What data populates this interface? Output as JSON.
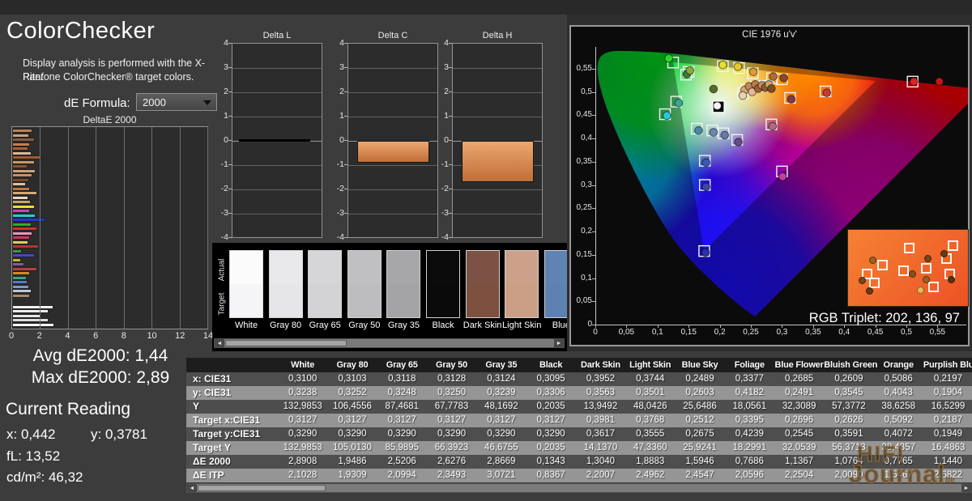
{
  "app": {
    "title": "ColorChecker",
    "description_line1": "Display analysis is performed with the X-Rite/",
    "description_line2": "Pantone ColorChecker® target colors.",
    "de_formula_label": "dE Formula:",
    "de_formula_value": "2000"
  },
  "stats": {
    "avg": "Avg dE2000: 1,44",
    "max": "Max dE2000: 2,89",
    "current_reading_label": "Current Reading",
    "x": "x: 0,442",
    "y": "y: 0,3781",
    "fl": "fL: 13,52",
    "cdm2": "cd/m²: 46,32"
  },
  "chart_data": [
    {
      "type": "bar",
      "title": "DeltaE 2000",
      "orientation": "horizontal",
      "xlim": [
        0,
        14
      ],
      "xticks": [
        "0",
        "2",
        "4",
        "6",
        "8",
        "10",
        "12",
        "14"
      ],
      "grid": true,
      "bars": [
        {
          "color": "#c08050",
          "value": 1.35
        },
        {
          "color": "#caa07a",
          "value": 1.1
        },
        {
          "color": "#8a5a3a",
          "value": 1.5
        },
        {
          "color": "#c08050",
          "value": 1.2
        },
        {
          "color": "#a86038",
          "value": 1.05
        },
        {
          "color": "#d8b896",
          "value": 1.3
        },
        {
          "color": "#a05a30",
          "value": 2.0
        },
        {
          "color": "#c8986a",
          "value": 1.5
        },
        {
          "color": "#905030",
          "value": 1.0
        },
        {
          "color": "#d0a070",
          "value": 1.6
        },
        {
          "color": "#c49068",
          "value": 1.35
        },
        {
          "color": "#7a4a2a",
          "value": 1.1
        },
        {
          "color": "#e0c0a0",
          "value": 0.85
        },
        {
          "color": "#b87848",
          "value": 1.15
        },
        {
          "color": "#d6a878",
          "value": 1.7
        },
        {
          "color": "#e8d8c0",
          "value": 1.05
        },
        {
          "color": "#caa06e",
          "value": 1.25
        },
        {
          "color": "#e8e030",
          "value": 1.55
        },
        {
          "color": "#d040c0",
          "value": 1.2
        },
        {
          "color": "#30c8d0",
          "value": 1.6
        },
        {
          "color": "#2038d0",
          "value": 2.3
        },
        {
          "color": "#28b028",
          "value": 1.3
        },
        {
          "color": "#d03030",
          "value": 1.7
        },
        {
          "color": "#e098b8",
          "value": 1.35
        },
        {
          "color": "#c03860",
          "value": 1.15
        },
        {
          "color": "#d8d060",
          "value": 1.05
        },
        {
          "color": "#b03838",
          "value": 1.8
        },
        {
          "color": "#489048",
          "value": 0.6
        },
        {
          "color": "#4848c0",
          "value": 1.5
        },
        {
          "color": "#b8b830",
          "value": 0.5
        },
        {
          "color": "#8858a8",
          "value": 0.75
        },
        {
          "color": "#b84040",
          "value": 1.7
        },
        {
          "color": "#d08830",
          "value": 1.2
        },
        {
          "color": "#38a878",
          "value": 0.95
        },
        {
          "color": "#5878c8",
          "value": 1.0
        },
        {
          "color": "#8898b8",
          "value": 1.1
        },
        {
          "color": "#b8c8d8",
          "value": 1.3
        },
        {
          "color": "#a88868",
          "value": 1.15
        }
      ],
      "white_bars": [
        {
          "color": "#f2f2f2",
          "value": 2.85
        },
        {
          "color": "#ececec",
          "value": 2.5
        },
        {
          "color": "#e6e6e6",
          "value": 2.0
        },
        {
          "color": "#dedede",
          "value": 2.5
        },
        {
          "color": "#f8f8f8",
          "value": 2.9
        }
      ]
    },
    {
      "type": "bar",
      "title": "Delta L",
      "ylim": [
        -4,
        4
      ],
      "yticks": [
        "4",
        "3",
        "2",
        "1",
        "0",
        "-1",
        "-2",
        "-3",
        "-4"
      ],
      "value": -0.05,
      "bar_style": "black"
    },
    {
      "type": "bar",
      "title": "Delta C",
      "ylim": [
        -4,
        4
      ],
      "yticks": [
        "4",
        "3",
        "2",
        "1",
        "0",
        "-1",
        "-2",
        "-3",
        "-4"
      ],
      "value": -0.9,
      "bar_style": "orange"
    },
    {
      "type": "bar",
      "title": "Delta H",
      "ylim": [
        -4,
        4
      ],
      "yticks": [
        "4",
        "3",
        "2",
        "1",
        "0",
        "-1",
        "-2",
        "-3",
        "-4"
      ],
      "value": -1.7,
      "bar_style": "orange"
    },
    {
      "type": "scatter",
      "title": "CIE 1976 u'v'",
      "xlim": [
        0,
        0.6
      ],
      "ylim": [
        0,
        0.6
      ],
      "xticks": [
        "0",
        "0,05",
        "0,1",
        "0,15",
        "0,2",
        "0,25",
        "0,3",
        "0,35",
        "0,4",
        "0,45",
        "0,5",
        "0,55"
      ],
      "yticks": [
        "0",
        "0,05",
        "0,1",
        "0,15",
        "0,2",
        "0,25",
        "0,3",
        "0,35",
        "0,4",
        "0,45",
        "0,5",
        "0,55"
      ],
      "whitepoint": {
        "u": 0.198,
        "v": 0.468
      },
      "targets": [
        [
          0.125,
          0.563
        ],
        [
          0.15,
          0.543
        ],
        [
          0.146,
          0.537
        ],
        [
          0.205,
          0.555
        ],
        [
          0.231,
          0.551
        ],
        [
          0.253,
          0.54
        ],
        [
          0.284,
          0.529
        ],
        [
          0.243,
          0.505
        ],
        [
          0.256,
          0.511
        ],
        [
          0.267,
          0.512
        ],
        [
          0.277,
          0.513
        ],
        [
          0.237,
          0.497
        ],
        [
          0.3,
          0.527
        ],
        [
          0.313,
          0.487
        ],
        [
          0.37,
          0.501
        ],
        [
          0.51,
          0.522
        ],
        [
          0.13,
          0.479
        ],
        [
          0.112,
          0.452
        ],
        [
          0.163,
          0.421
        ],
        [
          0.188,
          0.417
        ],
        [
          0.206,
          0.411
        ],
        [
          0.228,
          0.397
        ],
        [
          0.283,
          0.43
        ],
        [
          0.176,
          0.352
        ],
        [
          0.176,
          0.3
        ],
        [
          0.175,
          0.158
        ],
        [
          0.3,
          0.329
        ]
      ],
      "points": [
        [
          0.118,
          0.572,
          "#2fd42f"
        ],
        [
          0.147,
          0.538,
          "#3f7a30"
        ],
        [
          0.152,
          0.546,
          "#8aa83a"
        ],
        [
          0.19,
          0.506,
          "#5a6a2a"
        ],
        [
          0.205,
          0.558,
          "#e6df2e"
        ],
        [
          0.229,
          0.554,
          "#e8c62e"
        ],
        [
          0.254,
          0.543,
          "#e09a30"
        ],
        [
          0.286,
          0.533,
          "#b06c2e"
        ],
        [
          0.24,
          0.504,
          "#d8a878"
        ],
        [
          0.247,
          0.512,
          "#c08858"
        ],
        [
          0.252,
          0.5,
          "#e6b896"
        ],
        [
          0.257,
          0.516,
          "#b87a48"
        ],
        [
          0.262,
          0.507,
          "#a06030"
        ],
        [
          0.268,
          0.514,
          "#c89060"
        ],
        [
          0.273,
          0.509,
          "#8f5a28"
        ],
        [
          0.279,
          0.516,
          "#d0a070"
        ],
        [
          0.283,
          0.507,
          "#7e4e20"
        ],
        [
          0.237,
          0.492,
          "#ecd0b0"
        ],
        [
          0.303,
          0.53,
          "#8a4a2a"
        ],
        [
          0.315,
          0.484,
          "#803a4a"
        ],
        [
          0.372,
          0.498,
          "#c23a3a"
        ],
        [
          0.512,
          0.522,
          "#e02222"
        ],
        [
          0.553,
          0.522,
          "#c01818"
        ],
        [
          0.196,
          0.47,
          "#f4f4f4"
        ],
        [
          0.134,
          0.476,
          "#3aa898"
        ],
        [
          0.115,
          0.449,
          "#28c8d8"
        ],
        [
          0.166,
          0.417,
          "#4a88a8"
        ],
        [
          0.19,
          0.413,
          "#6888b0"
        ],
        [
          0.208,
          0.407,
          "#6878a8"
        ],
        [
          0.23,
          0.392,
          "#684a88"
        ],
        [
          0.285,
          0.426,
          "#b06a80"
        ],
        [
          0.178,
          0.348,
          "#3a58b8"
        ],
        [
          0.178,
          0.296,
          "#3848a0"
        ],
        [
          0.177,
          0.155,
          "#2830a8"
        ],
        [
          0.301,
          0.318,
          "#c2409a"
        ]
      ]
    }
  ],
  "cie": {
    "rgb_triplet": "RGB Triplet: 202, 136, 97",
    "inset_squares": [
      [
        0.52,
        0.2
      ],
      [
        0.27,
        0.47
      ],
      [
        0.13,
        0.62
      ],
      [
        0.2,
        0.75
      ],
      [
        0.47,
        0.57
      ],
      [
        0.68,
        0.52
      ],
      [
        0.75,
        0.82
      ],
      [
        0.87,
        0.37
      ],
      [
        0.93,
        0.17
      ],
      [
        0.9,
        0.62
      ]
    ],
    "inset_dots": [
      [
        0.18,
        0.4,
        "#a06020"
      ],
      [
        0.08,
        0.72,
        "#7a4418"
      ],
      [
        0.15,
        0.88,
        "#6a3a14"
      ],
      [
        0.55,
        0.62,
        "#8a5020"
      ],
      [
        0.63,
        0.87,
        "#e8b850"
      ],
      [
        0.7,
        0.37,
        "#7a4418"
      ],
      [
        0.85,
        0.3,
        "#6a3a14"
      ],
      [
        0.92,
        0.7,
        "#5a3210"
      ],
      [
        0.68,
        0.7,
        "#9a6028"
      ]
    ]
  },
  "swatches": {
    "actual_label": "Actual",
    "target_label": "Target",
    "items": [
      {
        "name": "White",
        "actual": "#fbfbfb",
        "target": "#f5f5f7"
      },
      {
        "name": "Gray 80",
        "actual": "#e9e9eb",
        "target": "#e6e6e8"
      },
      {
        "name": "Gray 65",
        "actual": "#d6d6d8",
        "target": "#d3d3d5"
      },
      {
        "name": "Gray 50",
        "actual": "#c0c0c2",
        "target": "#bdbdbf"
      },
      {
        "name": "Gray 35",
        "actual": "#a7a7a9",
        "target": "#a4a4a6"
      },
      {
        "name": "Black",
        "actual": "#0b0b0b",
        "target": "#0a0a0a"
      },
      {
        "name": "Dark Skin",
        "actual": "#7b5244",
        "target": "#7d5040"
      },
      {
        "name": "Light Skin",
        "actual": "#cda189",
        "target": "#cb9f85"
      },
      {
        "name": "Blue",
        "actual": "#5f83b2",
        "target": "#5d81b0"
      }
    ]
  },
  "table": {
    "columns": [
      "White",
      "Gray 80",
      "Gray 65",
      "Gray 50",
      "Gray 35",
      "Black",
      "Dark Skin",
      "Light Skin",
      "Blue Sky",
      "Foliage",
      "Blue Flower",
      "Bluish Green",
      "Orange",
      "Purplish Blu"
    ],
    "rows": [
      {
        "label": "x: CIE31",
        "values": [
          "0,3100",
          "0,3103",
          "0,3118",
          "0,3128",
          "0,3124",
          "0,3095",
          "0,3952",
          "0,3744",
          "0,2489",
          "0,3377",
          "0,2685",
          "0,2609",
          "0,5086",
          "0,2197"
        ]
      },
      {
        "label": "y: CIE31",
        "values": [
          "0,3238",
          "0,3252",
          "0,3248",
          "0,3250",
          "0,3239",
          "0,3306",
          "0,3563",
          "0,3501",
          "0,2603",
          "0,4182",
          "0,2491",
          "0,3545",
          "0,4043",
          "0,1904"
        ]
      },
      {
        "label": "Y",
        "values": [
          "132,9853",
          "106,4556",
          "87,4681",
          "67,7783",
          "48,1692",
          "0,2035",
          "13,9492",
          "48,0426",
          "25,6486",
          "18,0561",
          "32,3089",
          "57,3772",
          "38,6258",
          "16,5299"
        ]
      },
      {
        "label": "Target x:CIE31",
        "values": [
          "0,3127",
          "0,3127",
          "0,3127",
          "0,3127",
          "0,3127",
          "0,3127",
          "0,3981",
          "0,3768",
          "0,2512",
          "0,3395",
          "0,2696",
          "0,2626",
          "0,5092",
          "0,2187"
        ]
      },
      {
        "label": "Target y:CIE31",
        "values": [
          "0,3290",
          "0,3290",
          "0,3290",
          "0,3290",
          "0,3290",
          "0,3290",
          "0,3617",
          "0,3555",
          "0,2675",
          "0,4239",
          "0,2545",
          "0,3591",
          "0,4072",
          "0,1949"
        ]
      },
      {
        "label": "Target Y",
        "values": [
          "132,9853",
          "105,0130",
          "85,9895",
          "66,3923",
          "46,6755",
          "0,2035",
          "14,1370",
          "47,3360",
          "25,9241",
          "18,2991",
          "32,0539",
          "56,3713",
          "38,4357",
          "16,4863"
        ]
      },
      {
        "label": "ΔE 2000",
        "values": [
          "2,8908",
          "1,9486",
          "2,5206",
          "2,6276",
          "2,8669",
          "0,1343",
          "1,3040",
          "1,8883",
          "1,5946",
          "0,7686",
          "1,1367",
          "1,0764",
          "0,7765",
          "1,1440"
        ]
      },
      {
        "label": "ΔE ITP",
        "values": [
          "2,1028",
          "1,9309",
          "2,0994",
          "2,3493",
          "3,0721",
          "0,8367",
          "2,2007",
          "2,4962",
          "2,4547",
          "2,0596",
          "2,2504",
          "2,0090",
          "1,5467",
          "2,6822"
        ]
      }
    ]
  },
  "watermark": {
    "line1": "HIFI",
    "line2": "Journal",
    "suffix": "de"
  }
}
